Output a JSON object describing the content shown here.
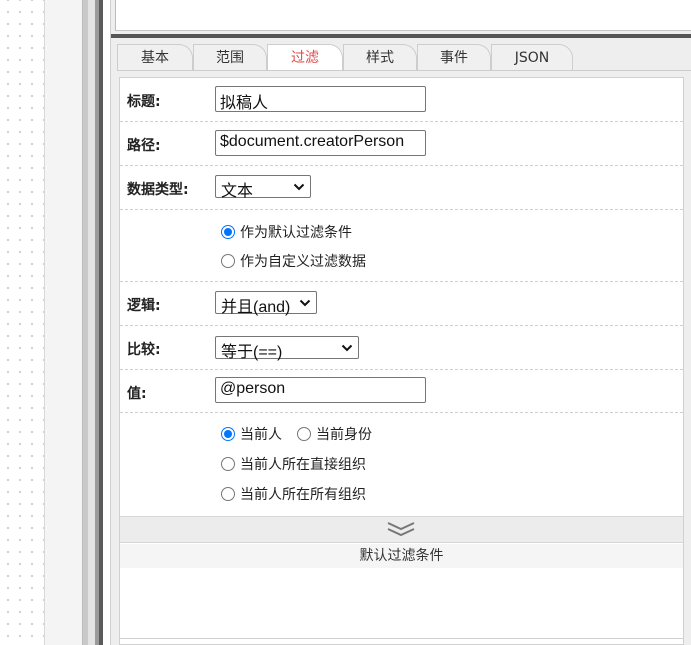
{
  "tabs": [
    "基本",
    "范围",
    "过滤",
    "样式",
    "事件",
    "JSON"
  ],
  "active_tab": "过滤",
  "accent_color": "#e24949",
  "radio_color": "#0075ff",
  "form": {
    "title_label": "标题:",
    "title_value": "拟稿人",
    "path_label": "路径:",
    "path_value": "$document.creatorPerson",
    "datatype_label": "数据类型:",
    "datatype_value": "文本",
    "filter_mode_options": [
      "作为默认过滤条件",
      "作为自定义过滤数据"
    ],
    "filter_mode_selected": "作为默认过滤条件",
    "logic_label": "逻辑:",
    "logic_value": "并且(and)",
    "compare_label": "比较:",
    "compare_value": "等于(==)",
    "value_label": "值:",
    "value_value": "@person",
    "value_options": [
      "当前人",
      "当前身份",
      "当前人所在直接组织",
      "当前人所在所有组织"
    ],
    "value_selected": "当前人"
  },
  "default_filter_title": "默认过滤条件",
  "icons": {
    "select_arrow": "chevron-down-icon",
    "collapse": "double-chevron-down-icon"
  }
}
